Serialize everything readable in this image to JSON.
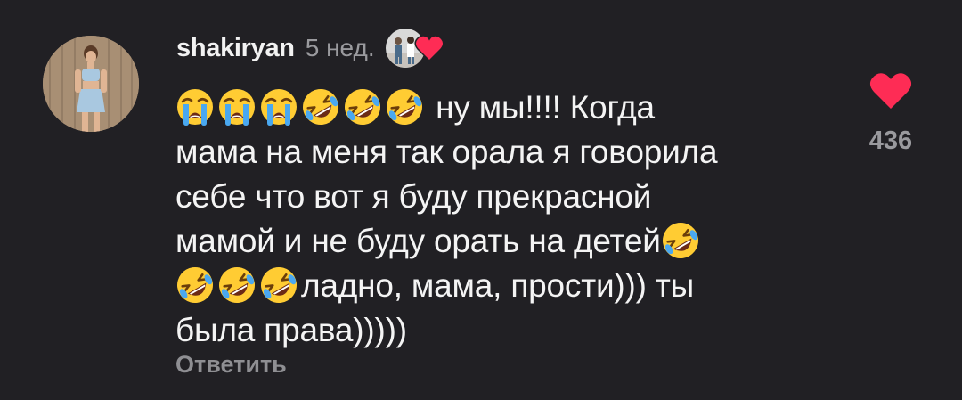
{
  "comment": {
    "username": "shakiryan",
    "time": "5 нед.",
    "text_line1_tail": "ну мы!!!! Когда",
    "text_line2": "мама на меня так орала я говорила",
    "text_line3": "себе что вот я буду прекрасной",
    "text_line4": "мамой и не буду орать на детей",
    "text_line5_tail": "ладно, мама, прости))) ты",
    "text_line6": "была права)))))",
    "reply_label": "Ответить",
    "like_count": "436",
    "liked_by_creator": true,
    "emojis_line1": [
      "loudly-crying-face",
      "loudly-crying-face",
      "loudly-crying-face",
      "rolling-on-floor-laughing",
      "rolling-on-floor-laughing",
      "rolling-on-floor-laughing"
    ],
    "emojis_line4_end": [
      "rolling-on-floor-laughing"
    ],
    "emojis_line5": [
      "rolling-on-floor-laughing",
      "rolling-on-floor-laughing",
      "rolling-on-floor-laughing"
    ]
  },
  "colors": {
    "background": "#212024",
    "heart": "#fe2c55",
    "muted_text": "#9a9a9e"
  }
}
